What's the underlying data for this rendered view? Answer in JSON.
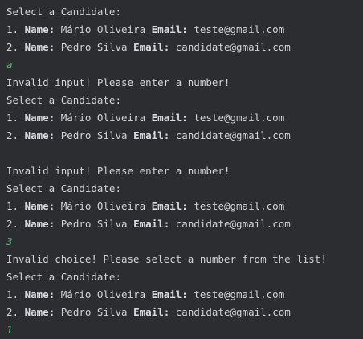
{
  "console": {
    "lines": [
      {
        "type": "text",
        "text": "Select a Candidate:"
      },
      {
        "type": "candidate",
        "num": "1.",
        "name_label": "Name:",
        "name": "Mário Oliveira",
        "email_label": "Email:",
        "email": "teste@gmail.com"
      },
      {
        "type": "candidate",
        "num": "2.",
        "name_label": "Name:",
        "name": "Pedro Silva",
        "email_label": "Email:",
        "email": "candidate@gmail.com"
      },
      {
        "type": "input",
        "text": "a"
      },
      {
        "type": "text",
        "text": "Invalid input! Please enter a number!"
      },
      {
        "type": "text",
        "text": "Select a Candidate:"
      },
      {
        "type": "candidate",
        "num": "1.",
        "name_label": "Name:",
        "name": "Mário Oliveira",
        "email_label": "Email:",
        "email": "teste@gmail.com"
      },
      {
        "type": "candidate",
        "num": "2.",
        "name_label": "Name:",
        "name": "Pedro Silva",
        "email_label": "Email:",
        "email": "candidate@gmail.com"
      },
      {
        "type": "blank",
        "text": ""
      },
      {
        "type": "text",
        "text": "Invalid input! Please enter a number!"
      },
      {
        "type": "text",
        "text": "Select a Candidate:"
      },
      {
        "type": "candidate",
        "num": "1.",
        "name_label": "Name:",
        "name": "Mário Oliveira",
        "email_label": "Email:",
        "email": "teste@gmail.com"
      },
      {
        "type": "candidate",
        "num": "2.",
        "name_label": "Name:",
        "name": "Pedro Silva",
        "email_label": "Email:",
        "email": "candidate@gmail.com"
      },
      {
        "type": "input",
        "text": "3"
      },
      {
        "type": "text",
        "text": "Invalid choice! Please select a number from the list!"
      },
      {
        "type": "text",
        "text": "Select a Candidate:"
      },
      {
        "type": "candidate",
        "num": "1.",
        "name_label": "Name:",
        "name": "Mário Oliveira",
        "email_label": "Email:",
        "email": "teste@gmail.com"
      },
      {
        "type": "candidate",
        "num": "2.",
        "name_label": "Name:",
        "name": "Pedro Silva",
        "email_label": "Email:",
        "email": "candidate@gmail.com"
      },
      {
        "type": "input",
        "text": "1"
      }
    ]
  },
  "colors": {
    "background": "#2b2d30",
    "text": "#cfd2d6",
    "user_input": "#5fb37a"
  }
}
